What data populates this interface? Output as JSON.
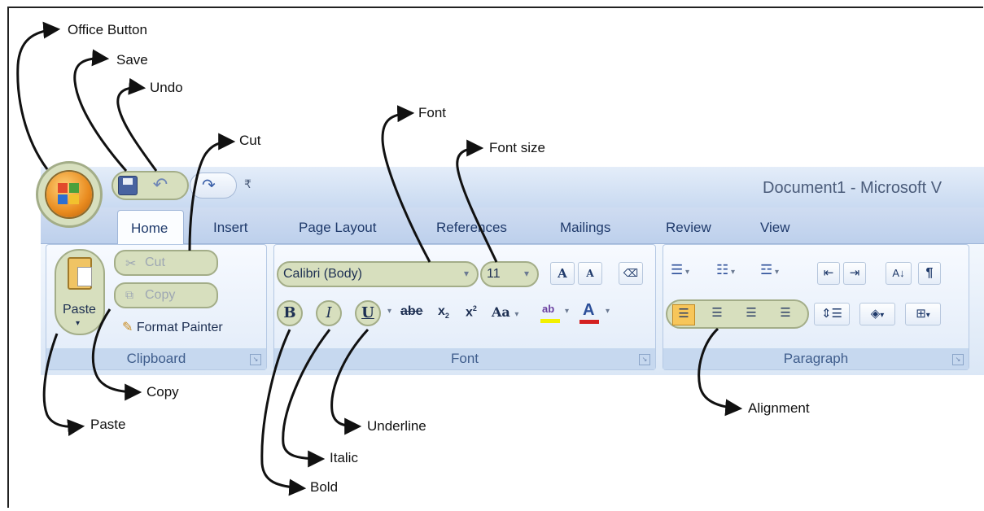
{
  "quick_access": {
    "title": "Document1 - Microsoft V"
  },
  "tabs": [
    "Home",
    "Insert",
    "Page Layout",
    "References",
    "Mailings",
    "Review",
    "View"
  ],
  "clipboard": {
    "paste": "Paste",
    "cut": "Cut",
    "copy": "Copy",
    "format_painter": "Format Painter",
    "label": "Clipboard"
  },
  "font": {
    "font_name": "Calibri (Body)",
    "font_size": "11",
    "label": "Font",
    "grow": "A",
    "shrink": "A",
    "bold": "B",
    "italic": "I",
    "underline": "U",
    "strike": "abe",
    "subscript": "x",
    "superscript": "x",
    "change_case": "Aa",
    "font_color": "A"
  },
  "paragraph": {
    "label": "Paragraph",
    "sort": "A↓",
    "pilcrow": "¶"
  },
  "annotations": {
    "office_button": "Office Button",
    "save": "Save",
    "undo": "Undo",
    "cut": "Cut",
    "font": "Font",
    "font_size": "Font size",
    "copy": "Copy",
    "paste": "Paste",
    "underline": "Underline",
    "italic": "Italic",
    "bold": "Bold",
    "alignment": "Alignment"
  }
}
